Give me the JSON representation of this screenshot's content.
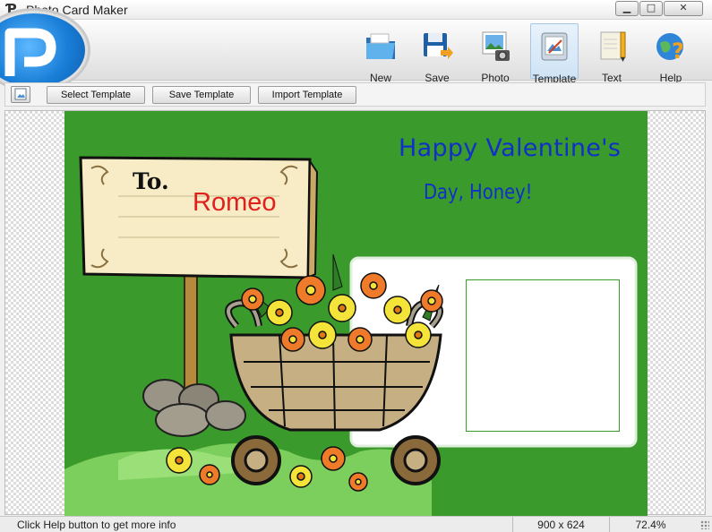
{
  "window": {
    "title": "Photo Card Maker",
    "icon": "app-p-icon",
    "controls": {
      "minimize": "▁",
      "maximize": "□",
      "close": "✕"
    }
  },
  "toolbar": {
    "items": [
      {
        "label": "New",
        "icon": "folder-icon",
        "active": false
      },
      {
        "label": "Save",
        "icon": "floppy-disk-icon",
        "active": false
      },
      {
        "label": "Photo",
        "icon": "camera-photo-icon",
        "active": false
      },
      {
        "label": "Template",
        "icon": "template-icon",
        "active": true
      },
      {
        "label": "Text",
        "icon": "text-pencil-icon",
        "active": false
      },
      {
        "label": "Help",
        "icon": "help-globe-icon",
        "active": false
      }
    ]
  },
  "subbar": {
    "select_template": "Select Template",
    "save_template": "Save Template",
    "import_template": "Import Template"
  },
  "card": {
    "greeting_line1": "Happy Valentine's",
    "greeting_line2": "Day, Honey!",
    "to_label": "To.",
    "to_name": "Romeo",
    "background_color": "#3a9a2b",
    "greeting_color": "#1030c8",
    "name_color": "#e0201c"
  },
  "status": {
    "message": "Click Help button to get more info",
    "size": "900 x 624",
    "zoom": "72.4%"
  }
}
